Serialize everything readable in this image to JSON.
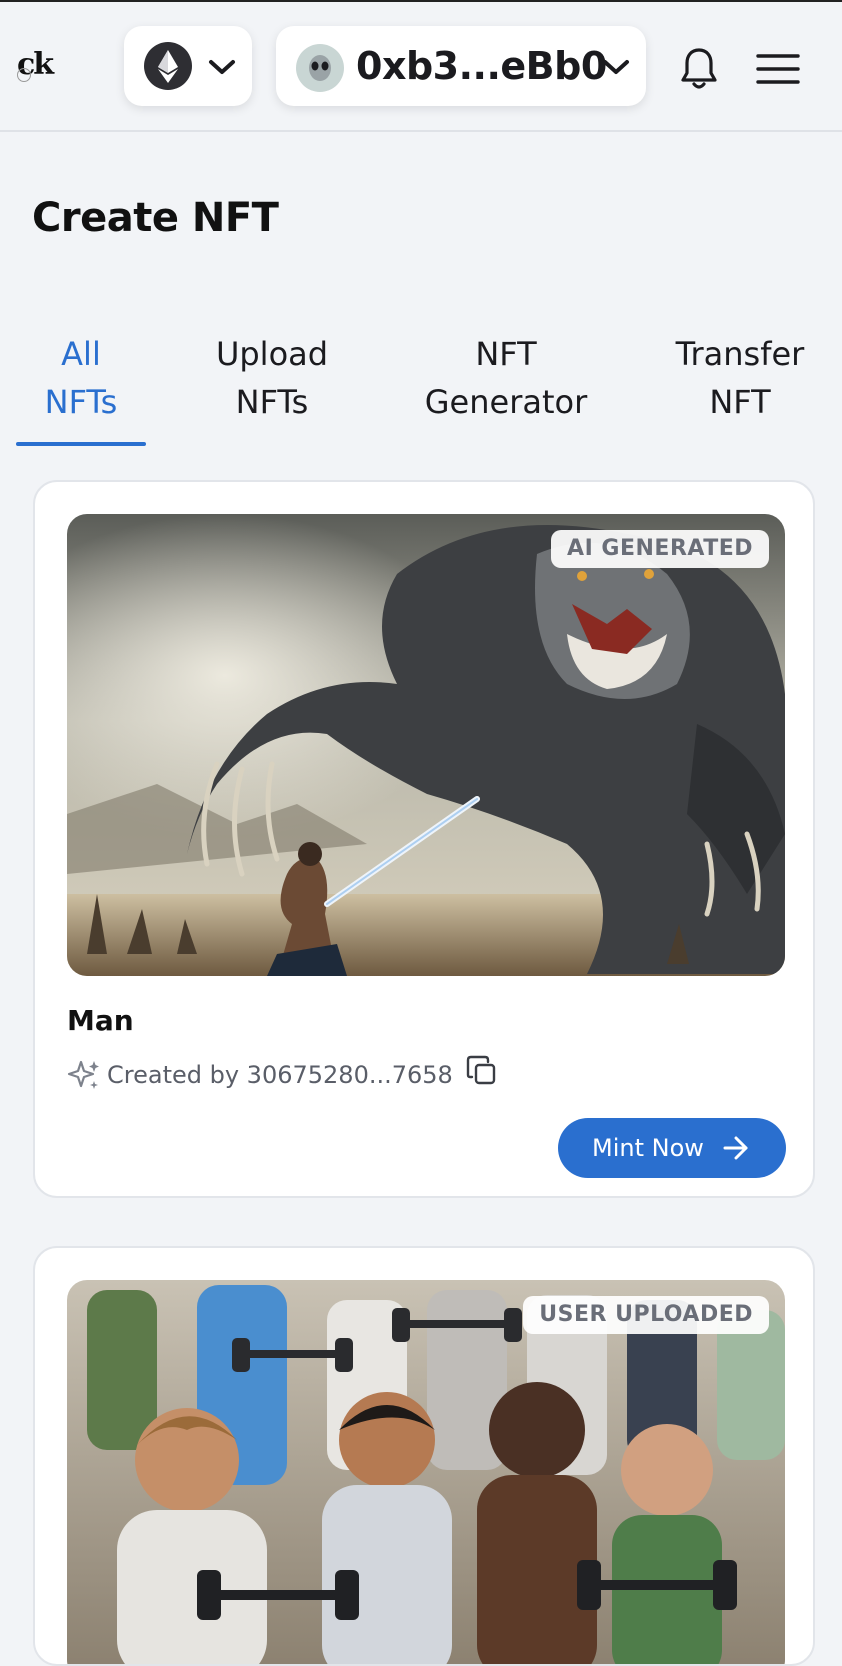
{
  "header": {
    "logo_text": "ck",
    "account_address": "0xb3...eBb0"
  },
  "page_title": "Create NFT",
  "tabs": [
    {
      "line1": "All",
      "line2": "NFTs",
      "active": true
    },
    {
      "line1": "Upload",
      "line2": "NFTs",
      "active": false
    },
    {
      "line1": "NFT",
      "line2": "Generator",
      "active": false
    },
    {
      "line1": "Transfer",
      "line2": "NFT",
      "active": false
    }
  ],
  "nfts": [
    {
      "badge": "AI GENERATED",
      "name": "Man",
      "creator": "Created by 30675280...7658",
      "mint_label": "Mint Now"
    },
    {
      "badge": "USER UPLOADED"
    }
  ],
  "colors": {
    "accent": "#2a6fcf",
    "background": "#f2f4f7"
  }
}
